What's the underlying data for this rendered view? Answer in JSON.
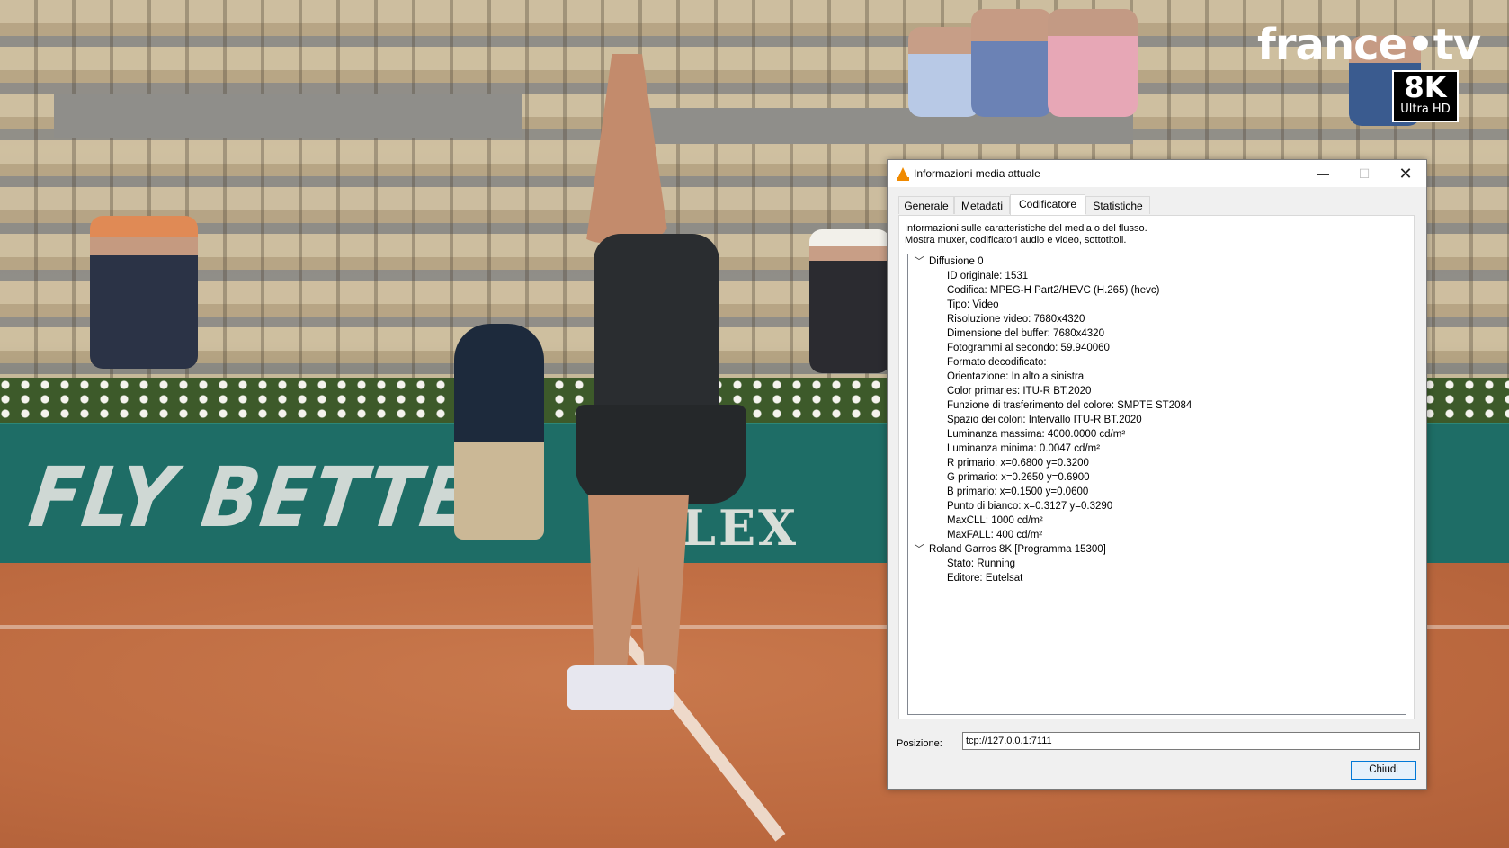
{
  "background": {
    "banner_text": "FLY BETTER",
    "banner_text_2": "OLEX",
    "brand": "france•tv",
    "badge_main": "8K",
    "badge_sub": "Ultra HD"
  },
  "dialog": {
    "title": "Informazioni media attuale",
    "window_controls": {
      "minimize": "—",
      "maximize": "☐",
      "close": "✕"
    },
    "tabs": [
      "Generale",
      "Metadati",
      "Codificatore",
      "Statistiche"
    ],
    "active_tab": "Codificatore",
    "description_line1": "Informazioni sulle caratteristiche del media o del flusso.",
    "description_line2": "Mostra muxer, codificatori audio e video, sottotitoli.",
    "tree": [
      {
        "label": "Diffusione 0",
        "items": [
          "ID originale: 1531",
          "Codifica: MPEG-H Part2/HEVC (H.265) (hevc)",
          "Tipo: Video",
          "Risoluzione video: 7680x4320",
          "Dimensione del buffer: 7680x4320",
          "Fotogrammi al secondo: 59.940060",
          "Formato decodificato:",
          "Orientazione: In alto a sinistra",
          "Color primaries: ITU-R BT.2020",
          "Funzione di trasferimento del colore: SMPTE ST2084",
          "Spazio dei colori: Intervallo ITU-R BT.2020",
          "Luminanza massima: 4000.0000 cd/m²",
          "Luminanza minima: 0.0047 cd/m²",
          "R primario: x=0.6800 y=0.3200",
          "G primario: x=0.2650 y=0.6900",
          "B primario: x=0.1500 y=0.0600",
          "Punto di bianco: x=0.3127 y=0.3290",
          "MaxCLL: 1000 cd/m²",
          "MaxFALL: 400 cd/m²"
        ]
      },
      {
        "label": "Roland Garros 8K [Programma 15300]",
        "items": [
          "Stato: Running",
          "Editore: Eutelsat"
        ]
      }
    ],
    "position_label": "Posizione:",
    "position_value": "tcp://127.0.0.1:7111",
    "close_label": "Chiudi"
  },
  "icons": {
    "app": "vlc-cone-icon",
    "expand": "chevron-down-icon"
  },
  "colors": {
    "accent": "#0078d7",
    "cone": "#f08a00",
    "banner": "#1e6d66",
    "clay": "#c46f45"
  }
}
